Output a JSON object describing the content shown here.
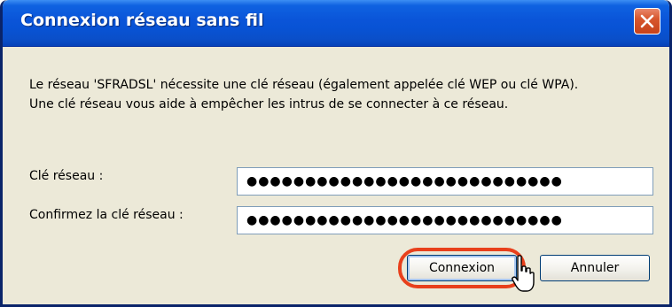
{
  "window": {
    "title": "Connexion réseau sans fil",
    "title_color": "#FFFFFF",
    "titlebar_color": "#0A54D8",
    "body_color": "#ECE9D8"
  },
  "description": {
    "line1": "Le réseau 'SFRADSL' nécessite une clé réseau (également appelée clé WEP ou clé WPA).",
    "line2": "Une clé réseau vous aide à empêcher les intrus de se connecter à ce réseau."
  },
  "fields": {
    "key_label": "Clé réseau :",
    "key_value": "●●●●●●●●●●●●●●●●●●●●●●●●●●●",
    "confirm_label": "Confirmez la clé réseau :",
    "confirm_value": "●●●●●●●●●●●●●●●●●●●●●●●●●●●"
  },
  "buttons": {
    "connect_label": "Connexion",
    "cancel_label": "Annuler"
  },
  "annotation": {
    "highlight_color": "#E8401C",
    "cursor": "hand-pointer-icon",
    "close_icon": "close-icon"
  }
}
